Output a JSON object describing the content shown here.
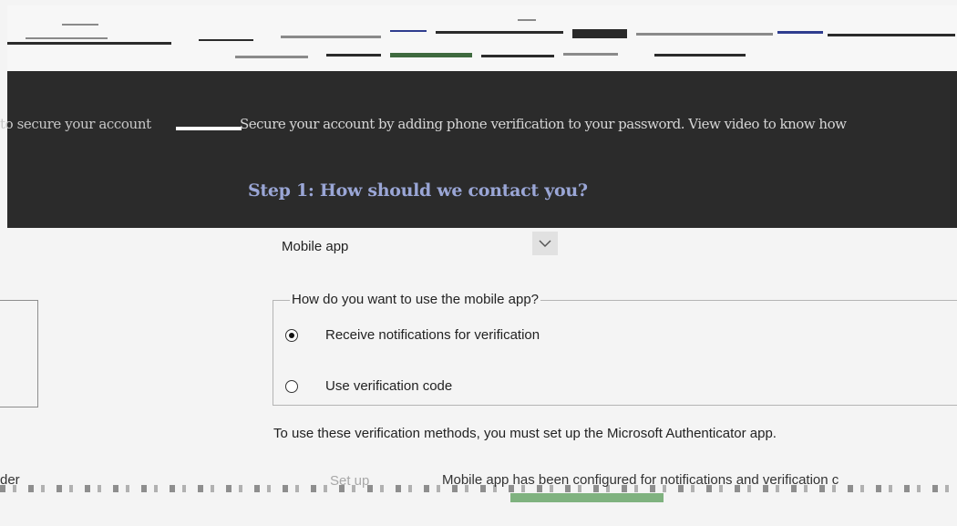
{
  "header": {
    "tab_left": "to secure your account",
    "description": "Secure your account by adding phone verification to your password. View video to know how"
  },
  "step": {
    "title": "Step 1: How should we contact you?"
  },
  "contact_method": {
    "selected": "Mobile app",
    "chevron_icon": "chevron-down-icon"
  },
  "mobile_app": {
    "legend": "How do you want to use the mobile app?",
    "options": [
      {
        "label": "Receive notifications for verification",
        "checked": true
      },
      {
        "label": "Use verification code",
        "checked": false
      }
    ]
  },
  "help_text": "To use these verification methods, you must set up the Microsoft Authenticator app.",
  "bottom": {
    "left_text": "der",
    "setup_label": "Set up",
    "status": "Mobile app has been configured for notifications and verification c"
  },
  "colors": {
    "dark_band": "#2b2b2b",
    "step_title": "#9aa6d6",
    "page_bg": "#f4f4f4",
    "progress_green": "#7fb27f"
  }
}
